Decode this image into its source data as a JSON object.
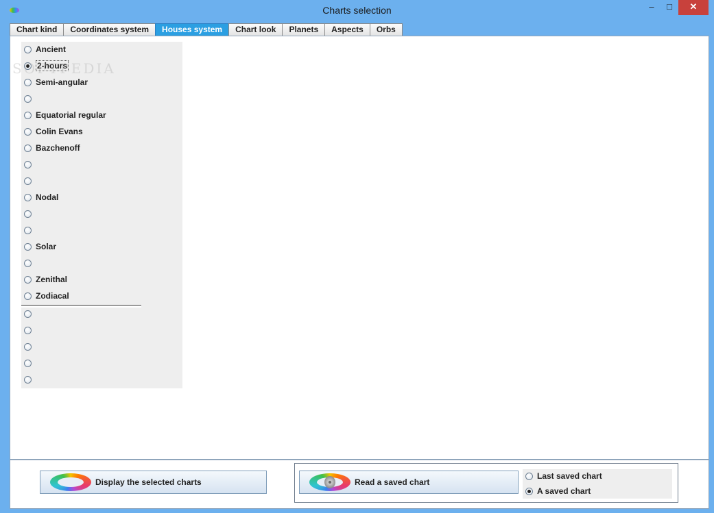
{
  "window": {
    "title": "Charts selection",
    "controls": {
      "minimize": "–",
      "maximize": "□",
      "close": "✕"
    }
  },
  "tabs": [
    {
      "label": "Chart kind",
      "active": false
    },
    {
      "label": "Coordinates system",
      "active": false
    },
    {
      "label": "Houses system",
      "active": true
    },
    {
      "label": "Chart look",
      "active": false
    },
    {
      "label": "Planets",
      "active": false
    },
    {
      "label": "Aspects",
      "active": false
    },
    {
      "label": "Orbs",
      "active": false
    }
  ],
  "houses": {
    "options": [
      {
        "label": "Ancient",
        "checked": false
      },
      {
        "label": "2-hours",
        "checked": true
      },
      {
        "label": "Semi-angular",
        "checked": false
      },
      {
        "label": "",
        "checked": false
      },
      {
        "label": "Equatorial regular",
        "checked": false
      },
      {
        "label": "Colin Evans",
        "checked": false
      },
      {
        "label": "Bazchenoff",
        "checked": false
      },
      {
        "label": "",
        "checked": false
      },
      {
        "label": "",
        "checked": false
      },
      {
        "label": "Nodal",
        "checked": false
      },
      {
        "label": "",
        "checked": false
      },
      {
        "label": "",
        "checked": false
      },
      {
        "label": "Solar",
        "checked": false
      },
      {
        "label": "",
        "checked": false
      },
      {
        "label": "Zenithal",
        "checked": false
      },
      {
        "label": "Zodiacal",
        "checked": false
      }
    ],
    "extra_options": [
      {
        "label": "",
        "checked": false
      },
      {
        "label": "",
        "checked": false
      },
      {
        "label": "",
        "checked": false
      },
      {
        "label": "",
        "checked": false
      },
      {
        "label": "",
        "checked": false
      }
    ]
  },
  "watermark": "SOFTPEDIA",
  "bottom": {
    "display_button": "Display the selected charts",
    "read_button": "Read a saved chart",
    "read_options": [
      {
        "label": "Last saved chart",
        "checked": false
      },
      {
        "label": "A saved chart",
        "checked": true
      }
    ]
  }
}
